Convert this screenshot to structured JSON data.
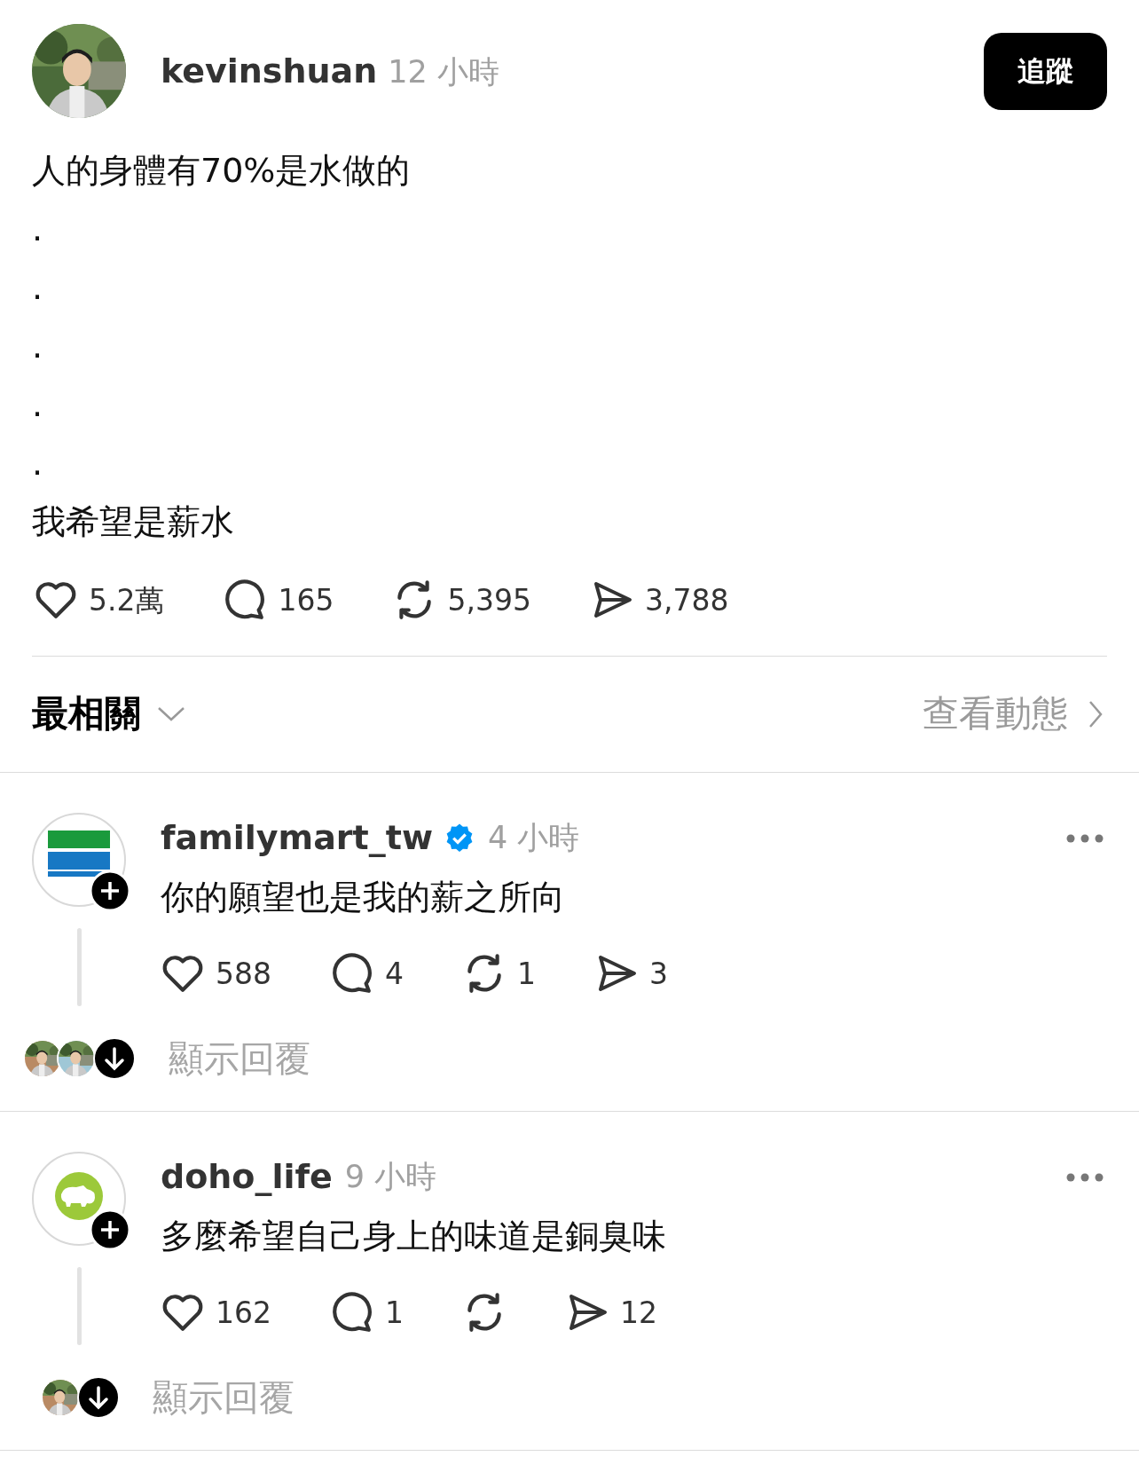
{
  "post": {
    "author": {
      "username": "kevinshuan",
      "time": "12 小時"
    },
    "follow_button": "追蹤",
    "lines": [
      "人的身體有70%是水做的",
      ".",
      ".",
      ".",
      ".",
      ".",
      "我希望是薪水"
    ],
    "actions": [
      {
        "kind": "like",
        "count": "5.2萬"
      },
      {
        "kind": "comment",
        "count": "165"
      },
      {
        "kind": "repost",
        "count": "5,395"
      },
      {
        "kind": "share",
        "count": "3,788"
      }
    ]
  },
  "sort": {
    "label": "最相關",
    "activity_link": "查看動態"
  },
  "comments": [
    {
      "username": "familymart_tw",
      "verified": true,
      "time": "4 小時",
      "avatar": {
        "kind": "stripes"
      },
      "text": "你的願望也是我的薪之所向",
      "actions": [
        {
          "kind": "like",
          "count": "588"
        },
        {
          "kind": "comment",
          "count": "4"
        },
        {
          "kind": "repost",
          "count": "1"
        },
        {
          "kind": "share",
          "count": "3"
        }
      ],
      "show_replies": "顯示回覆"
    },
    {
      "username": "doho_life",
      "verified": false,
      "time": "9 小時",
      "avatar": {
        "kind": "hippo"
      },
      "text": "多麼希望自己身上的味道是銅臭味",
      "actions": [
        {
          "kind": "like",
          "count": "162"
        },
        {
          "kind": "comment",
          "count": "1"
        },
        {
          "kind": "repost"
        },
        {
          "kind": "share",
          "count": "12"
        }
      ],
      "show_replies": "顯示回覆"
    }
  ]
}
